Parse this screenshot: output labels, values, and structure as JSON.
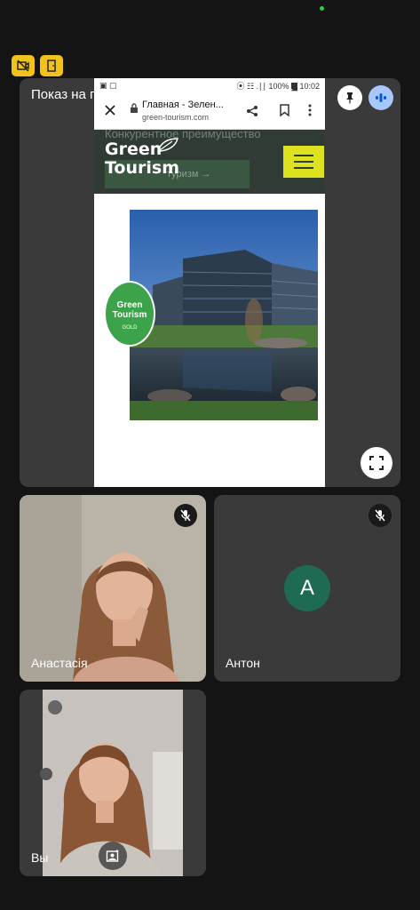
{
  "top_badges": [
    {
      "icon": "no-video-badge-icon"
    },
    {
      "icon": "door-exit-badge-icon"
    }
  ],
  "share": {
    "title": "Показ на главном экране: Вікторія Анатолі..."
  },
  "phone": {
    "status_left": "▣ ▢",
    "status_right": "⦿ ☷ .∣∣ 100% ▇ 10:02",
    "tab_title": "Главная - Зелен...",
    "url": "green-tourism.com",
    "banner_text": "Конкурентное преимущество",
    "ghost_button_text": "туризм  →",
    "logo_line1": "Green",
    "logo_line2": "Tourism",
    "badge_line1": "Green",
    "badge_line2": "Tourism",
    "badge_line3": "GOLD"
  },
  "participants": [
    {
      "name": "Анастасія",
      "muted": true,
      "video": true
    },
    {
      "name": "Антон",
      "muted": true,
      "video": false,
      "initial": "A",
      "avatar_color": "#1e6a54"
    },
    {
      "name": "Вы",
      "muted": false,
      "video": true
    }
  ],
  "colors": {
    "tile_bg": "#3a3a3b",
    "badge_yellow": "#f2c21b",
    "audio_active": "#a8c7fa",
    "site_dark": "#2f3b34",
    "site_accent": "#dde21f"
  }
}
